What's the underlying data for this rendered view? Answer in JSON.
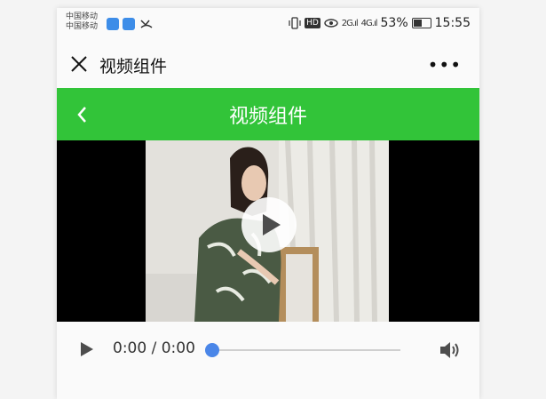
{
  "status_bar": {
    "carrier_1": "中国移动",
    "carrier_2": "中国移动",
    "signal_2g": "2G",
    "signal_4g": "4G",
    "hd_badge": "HD",
    "battery": "53%",
    "time": "15:55"
  },
  "title_bar": {
    "title": "视频组件",
    "more": "•••"
  },
  "nav_bar": {
    "title": "视频组件",
    "color": "#32c439"
  },
  "video": {
    "current_time": "0:00",
    "duration": "0:00",
    "time_separator": " / ",
    "progress": 0,
    "accent": "#4a86e8"
  },
  "icons": [
    "close-icon",
    "more-icon",
    "back-icon",
    "play-icon",
    "volume-icon"
  ]
}
